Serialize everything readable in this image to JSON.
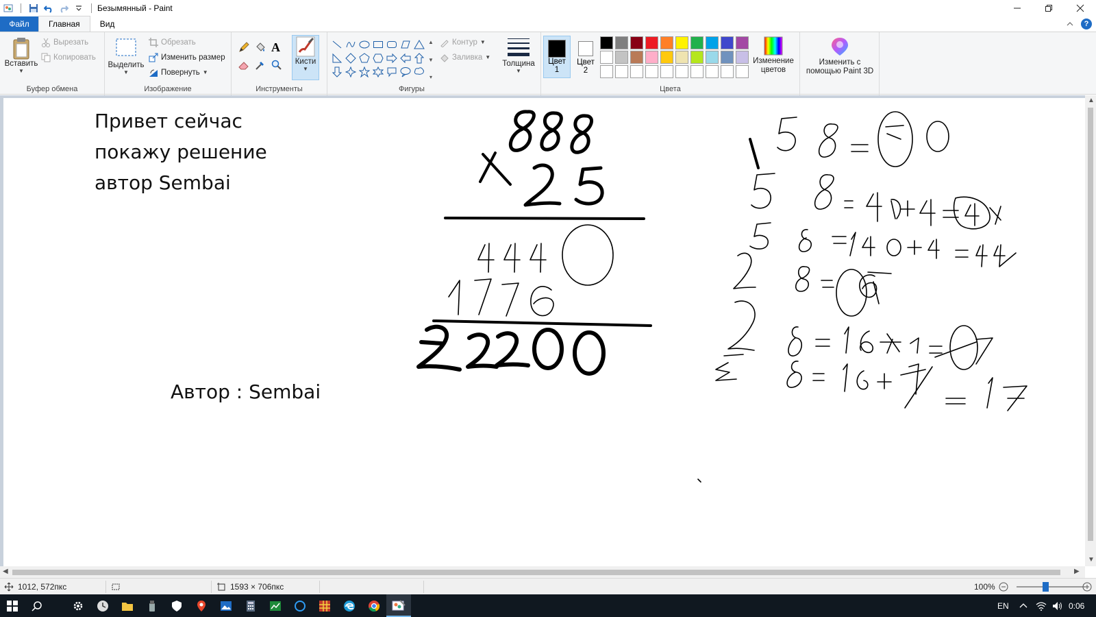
{
  "window": {
    "title": "Безымянный - Paint"
  },
  "tabs": [
    {
      "label": "Файл"
    },
    {
      "label": "Главная"
    },
    {
      "label": "Вид"
    }
  ],
  "ribbon": {
    "clipboard": {
      "label": "Буфер обмена",
      "paste": "Вставить",
      "cut": "Вырезать",
      "copy": "Копировать"
    },
    "image": {
      "label": "Изображение",
      "select": "Выделить",
      "crop": "Обрезать",
      "resize": "Изменить размер",
      "rotate": "Повернуть"
    },
    "tools": {
      "label": "Инструменты",
      "brushes": "Кисти"
    },
    "shapes": {
      "label": "Фигуры",
      "outline": "Контур",
      "fill": "Заливка"
    },
    "thickness": "Толщина",
    "colors": {
      "label": "Цвета",
      "color1_a": "Цвет",
      "color1_b": "1",
      "color2_a": "Цвет",
      "color2_b": "2",
      "edit_a": "Изменение",
      "edit_b": "цветов",
      "color1_value": "#000000",
      "color2_value": "#ffffff",
      "palette": [
        "#000000",
        "#7f7f7f",
        "#880015",
        "#ed1c24",
        "#ff7f27",
        "#fff200",
        "#22b14c",
        "#00a2e8",
        "#3f48cc",
        "#a349a4",
        "#ffffff",
        "#c3c3c3",
        "#b97a57",
        "#ffaec9",
        "#ffc90e",
        "#efe4b0",
        "#b5e61d",
        "#99d9ea",
        "#7092be",
        "#c8bfe7",
        "#ffffff",
        "#ffffff",
        "#ffffff",
        "#ffffff",
        "#ffffff",
        "#ffffff",
        "#ffffff",
        "#ffffff",
        "#ffffff",
        "#ffffff"
      ]
    },
    "paint3d_a": "Изменить с",
    "paint3d_b": "помощью Paint 3D"
  },
  "canvas": {
    "text1": [
      "Привет сейчас",
      "покажу решение",
      "автор Sembai"
    ],
    "text2": "Автор : Sembai"
  },
  "status": {
    "cursor_pos": "1012, 572пкс",
    "image_size": "1593 × 706пкс",
    "zoom": "100%"
  },
  "taskbar": {
    "lang": "EN",
    "time": "0:06"
  }
}
